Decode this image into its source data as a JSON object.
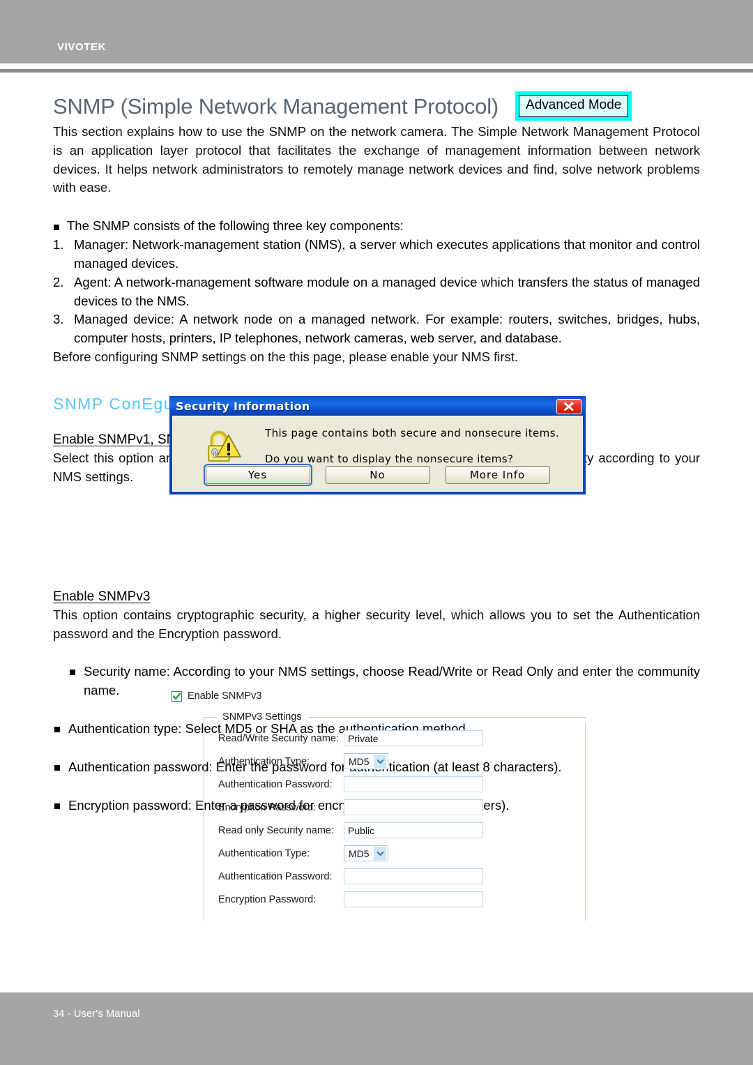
{
  "header": {
    "brand": "VIVOTEK"
  },
  "title": {
    "heading": "SNMP (Simple Network Management Protocol)",
    "badge": "Advanced Mode"
  },
  "intro": "This section explains how to use the SNMP on the network camera. The Simple Network Management Protocol is an application layer protocol that facilitates the exchange of management information between network devices. It helps network administrators to remotely manage network devices and find, solve network problems with ease.",
  "components": {
    "lead": "The SNMP consists of the following three key components:",
    "items": [
      {
        "num": "1.",
        "text": "Manager: Network-management station (NMS), a server which executes applications that monitor and control managed devices."
      },
      {
        "num": "2.",
        "text": "Agent: A network-management software module on a managed device which transfers the status of managed devices to the NMS."
      },
      {
        "num": "3.",
        "text": "Managed device: A network node on a managed network. For example: routers, switches, bridges, hubs, computer hosts, printers, IP telephones, network cameras, web server, and database."
      }
    ]
  },
  "before_note": "Before configuring SNMP settings on the this page, please enable your NMS first.",
  "section": {
    "heading": "SNMP ConEguration",
    "heading_color": "#59c6f2"
  },
  "v1v2c": {
    "sub_heading": "Enable SNMPv1, SNMPv2c",
    "body": "Select this option and enter the names of Read/Write community and Read Only community according to your NMS settings."
  },
  "dialog": {
    "title": "Security Information",
    "icon": "lock-warning-icon",
    "close_icon": "close-icon",
    "message_line1": "This page contains both secure and nonsecure items.",
    "message_line2": "Do you want to display the nonsecure items?",
    "buttons": [
      {
        "label": "Yes",
        "default": true
      },
      {
        "label": "No",
        "default": false
      },
      {
        "label": "More Info",
        "default": false
      }
    ]
  },
  "v3": {
    "sub_heading": "Enable SNMPv3",
    "body": "This option contains cryptographic security, a higher security level, which allows you to set the Authentication password and the Encryption password.",
    "bullets": [
      "Security name: According to your NMS settings, choose Read/Write or Read Only and enter the community name.",
      "Authentication type: Select MD5 or SHA as the authentication method.",
      "Authentication password: Enter the password for authentication (at least 8 characters).",
      "Encryption password: Enter a password for encryption (at least 8 characters)."
    ]
  },
  "form": {
    "enable_checkbox_label": "Enable SNMPv3",
    "enable_checked": true,
    "legend": "SNMPv3 Settings",
    "rows": [
      {
        "label": "Read/Write Security name:",
        "type": "text",
        "value": "Private"
      },
      {
        "label": "Authentication Type:",
        "type": "select",
        "value": "MD5"
      },
      {
        "label": "Authentication Password:",
        "type": "text",
        "value": ""
      },
      {
        "label": "Encryption Password:",
        "type": "text",
        "value": ""
      },
      {
        "label": "Read only Security name:",
        "type": "text",
        "value": "Public"
      },
      {
        "label": "Authentication Type:",
        "type": "select",
        "value": "MD5"
      },
      {
        "label": "Authentication Password:",
        "type": "text",
        "value": ""
      },
      {
        "label": "Encryption Password:",
        "type": "text",
        "value": ""
      }
    ]
  },
  "footer": {
    "text": "34 - User's Manual"
  }
}
